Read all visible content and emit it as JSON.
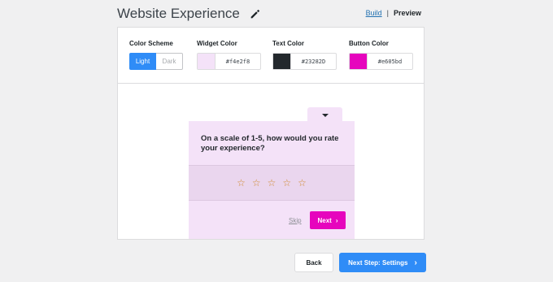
{
  "header": {
    "title": "Website Experience",
    "edit_icon": "pencil-icon",
    "links": {
      "build": "Build",
      "separator": "|",
      "preview": "Preview"
    }
  },
  "settings": {
    "color_scheme": {
      "label": "Color Scheme",
      "options": [
        "Light",
        "Dark"
      ],
      "selected": "Light"
    },
    "widget_color": {
      "label": "Widget Color",
      "value": "#f4e2f8"
    },
    "text_color": {
      "label": "Text Color",
      "value": "#23282D"
    },
    "button_color": {
      "label": "Button Color",
      "value": "#e605bd"
    }
  },
  "widget": {
    "toggle_icon": "caret-down-icon",
    "question": "On a scale of 1-5, how would you rate your experience?",
    "stars": [
      "☆",
      "☆",
      "☆",
      "☆",
      "☆"
    ],
    "skip_label": "Skip",
    "next_label": "Next",
    "next_icon": "›"
  },
  "footer": {
    "back_label": "Back",
    "next_step_label": "Next Step: Settings",
    "next_step_icon": "›"
  },
  "colors": {
    "accent_blue": "#2f8cf7",
    "widget_bg": "#f4e2f8",
    "text": "#23282d",
    "button": "#e605bd",
    "star": "#d18a2e"
  }
}
